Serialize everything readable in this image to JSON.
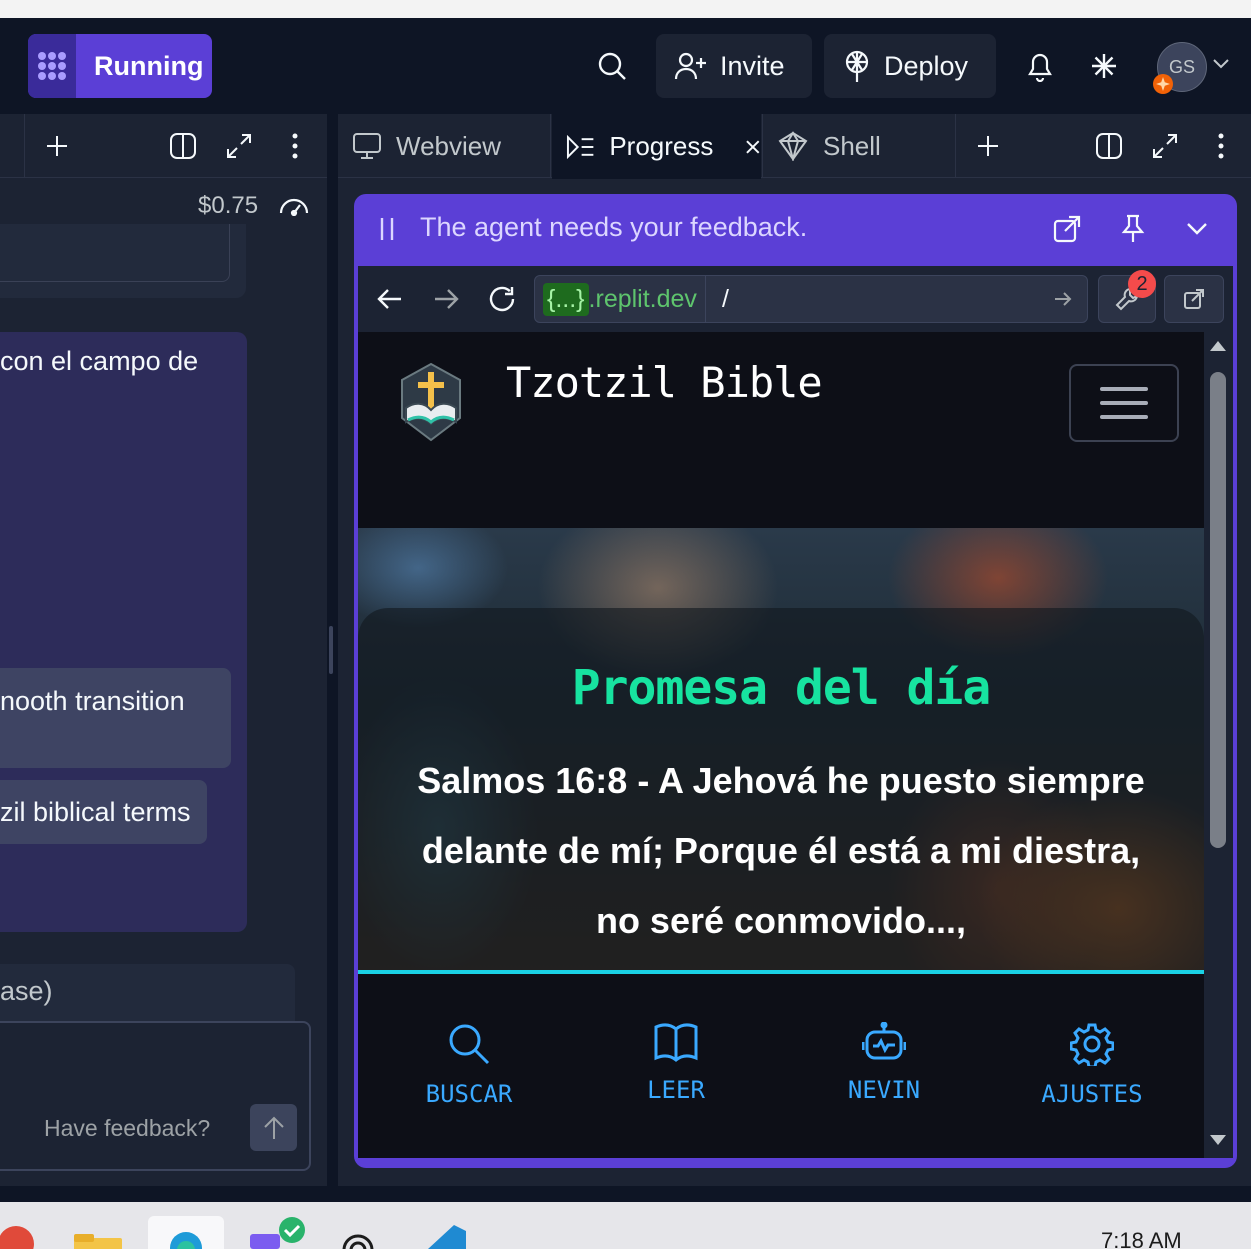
{
  "topbar": {
    "run_label": "Running",
    "invite_label": "Invite",
    "deploy_label": "Deploy",
    "avatar_initials": "GS",
    "accent": "#5b3fd6"
  },
  "left_pane": {
    "cost": "$0.75",
    "agent_text": "con el campo de",
    "chip_1": "nooth transition",
    "chip_2": "zil biblical terms",
    "input_placeholder": "ase)",
    "feedback_label": "Have feedback?"
  },
  "right_pane": {
    "tabs": [
      {
        "label": "Webview",
        "icon": "monitor-icon"
      },
      {
        "label": "Progress",
        "icon": "progress-list-icon"
      },
      {
        "label": "Shell",
        "icon": "shell-icon"
      }
    ],
    "feedback_banner": "The agent needs your feedback.",
    "url_host_braces": "{...}",
    "url_host_suffix": ".replit.dev",
    "url_path": "/",
    "devtools_badge": "2"
  },
  "site": {
    "title": "Tzotzil Bible",
    "promise_title": "Promesa del día",
    "promise_text": "Salmos 16:8 - A Jehová he puesto siempre delante de mí; Porque él está a mi diestra, no seré conmovido...,",
    "nav": [
      {
        "label": "BUSCAR",
        "icon": "search-icon"
      },
      {
        "label": "LEER",
        "icon": "book-icon"
      },
      {
        "label": "NEVIN",
        "icon": "robot-icon"
      },
      {
        "label": "AJUSTES",
        "icon": "gear-icon"
      }
    ],
    "accent_green": "#17e3a0",
    "accent_blue": "#3aa9ff"
  },
  "taskbar": {
    "clock": "7:18 AM"
  }
}
